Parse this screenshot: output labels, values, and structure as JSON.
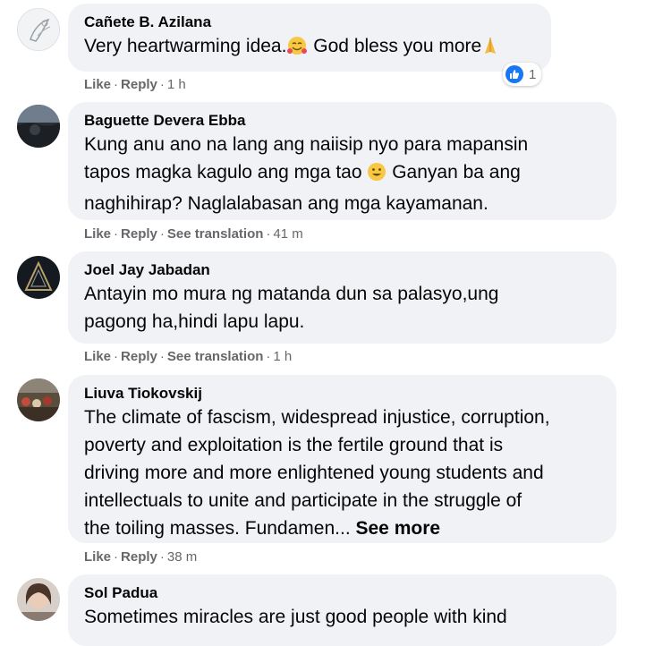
{
  "colors": {
    "bubble_bg": "#f0f2f5",
    "meta_text": "#65676b",
    "like_blue": "#1877f2"
  },
  "actions": {
    "like": "Like",
    "reply": "Reply",
    "see_translation": "See translation",
    "separator": "·"
  },
  "comments": [
    {
      "author": "Cañete B. Azilana",
      "text": "Very heartwarming idea.",
      "text_after_emoji": " God bless you more",
      "time": "1 h",
      "reaction_count": "1",
      "reaction_icon": "thumbs-up-icon",
      "emoji_1": "smiling-face-with-hearts-emoji",
      "emoji_2": "folded-hands-emoji"
    },
    {
      "author": "Baguette Devera Ebba",
      "text_line1": "Kung anu ano na lang ang naiisip nyo para mapansin",
      "text_line2a": "tapos magka kagulo ang mga tao ",
      "text_line2b": " Ganyan ba ang",
      "text_line3": "naghihirap? Naglalabasan ang mga kayamanan.",
      "time": "41 m",
      "emoji": "smiling-face-emoji"
    },
    {
      "author": "Joel Jay Jabadan",
      "text_line1": "Antayin mo mura ng matanda dun sa palasyo,ung",
      "text_line2": "pagong ha,hindi lapu lapu.",
      "time": "1 h"
    },
    {
      "author": "Liuva Tiokovskij",
      "text_line1": "The climate of fascism, widespread injustice, corruption,",
      "text_line2": "poverty and exploitation is the fertile ground that is",
      "text_line3": "driving more and more enlightened young students and",
      "text_line4": "intellectuals to unite and participate in the struggle of",
      "text_line5": "the toiling masses. Fundamen...",
      "see_more": "See more",
      "time": "38 m"
    },
    {
      "author": "Sol Padua",
      "text_line1": "Sometimes miracles are just good people with kind"
    }
  ]
}
